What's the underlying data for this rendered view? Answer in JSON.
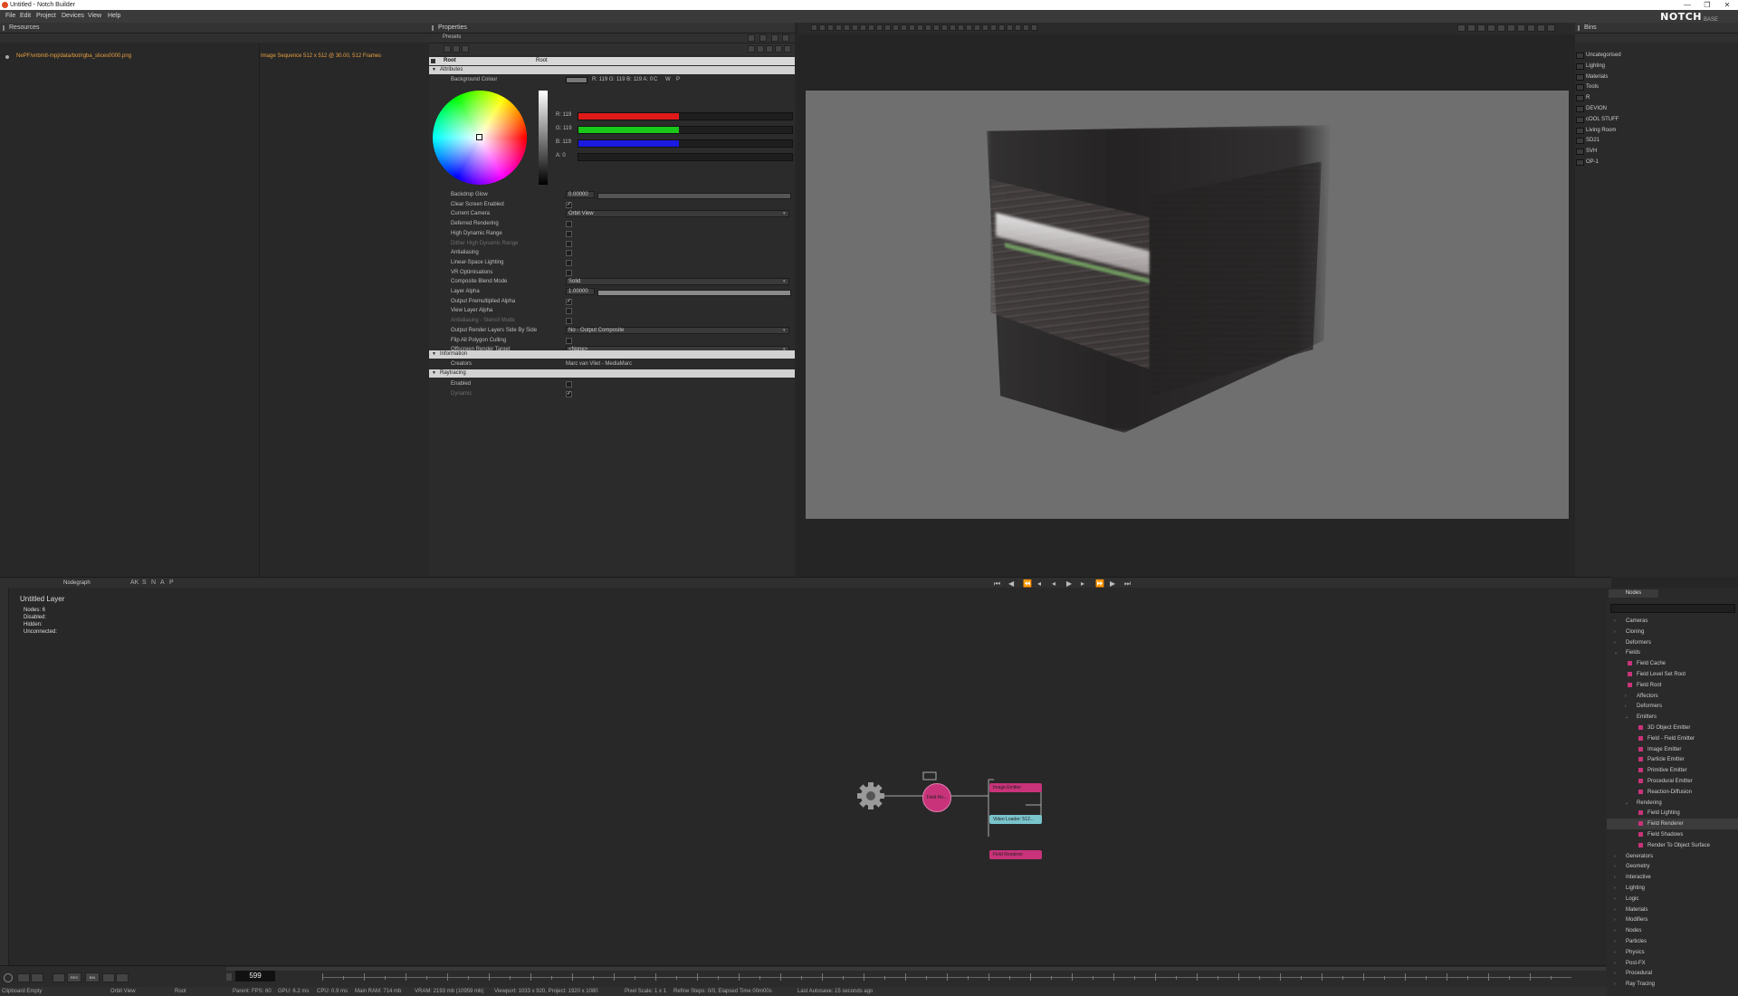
{
  "window": {
    "title": "Untitled - Notch Builder",
    "min": "—",
    "max": "❐",
    "close": "✕"
  },
  "menu": [
    "File",
    "Edit",
    "Project",
    "Devices",
    "View",
    "Help"
  ],
  "logo": {
    "text": "NOTCH",
    "sub": "BASE"
  },
  "resources": {
    "header": "Resources",
    "file_path": "NePF/vnbmtl-rnpj/data/bot/rgba_slices0000.png",
    "file_info": "Image Sequence 512 x 512 @ 30.00, 512 Frames"
  },
  "properties": {
    "header": "Properties",
    "presets": "Presets",
    "root_label": "Root",
    "root_value": "Root",
    "attributes": "Attributes",
    "background_colour": "Background Colour",
    "colour_summary": "R: 119  G: 119  B: 119  A: 0",
    "colour_btns": [
      "C",
      "W",
      "P"
    ],
    "channels": [
      {
        "label": "R: 119",
        "value": 0.47,
        "color": "#e01a1a"
      },
      {
        "label": "G: 119",
        "value": 0.47,
        "color": "#1ac81a"
      },
      {
        "label": "B: 119",
        "value": 0.47,
        "color": "#1a1ae0"
      },
      {
        "label": "A: 0",
        "value": 0.0,
        "color": "#888888"
      }
    ],
    "rows": [
      {
        "label": "Backdrop Glow",
        "type": "number",
        "value": "0.00000",
        "slider": 0.0
      },
      {
        "label": "Clear Screen Enabled",
        "type": "check",
        "checked": true
      },
      {
        "label": "Current Camera",
        "type": "select",
        "value": "Orbit View"
      },
      {
        "label": "Deferred Rendering",
        "type": "check",
        "checked": false
      },
      {
        "label": "High Dynamic Range",
        "type": "check",
        "checked": false
      },
      {
        "label": "Dither High Dynamic Range",
        "type": "check",
        "checked": false,
        "dim": true
      },
      {
        "label": "Antialiasing",
        "type": "check",
        "checked": false
      },
      {
        "label": "Linear-Space Lighting",
        "type": "check",
        "checked": false
      },
      {
        "label": "VR Optimisations",
        "type": "check",
        "checked": false
      },
      {
        "label": "Composite Blend Mode",
        "type": "select",
        "value": "Solid"
      },
      {
        "label": "Layer Alpha",
        "type": "number",
        "value": "1.00000",
        "slider": 1.0
      },
      {
        "label": "Output Premultiplied Alpha",
        "type": "check",
        "checked": true
      },
      {
        "label": "View Layer Alpha",
        "type": "check",
        "checked": false
      },
      {
        "label": "Antialiasing - Stencil Mode",
        "type": "check",
        "checked": false,
        "dim": true
      },
      {
        "label": "Output Render Layers Side By Side",
        "type": "select",
        "value": "No - Output Composite"
      },
      {
        "label": "Flip All Polygon Culling",
        "type": "check",
        "checked": false
      },
      {
        "label": "Offscreen Render Target",
        "type": "select",
        "value": "<None>"
      }
    ],
    "information": "Information",
    "creators_label": "Creators",
    "creators_value": "Marc van Vliet - MediaMarc",
    "raytracing": "Raytracing",
    "ray_rows": [
      {
        "label": "Enabled",
        "checked": false
      },
      {
        "label": "Dynamic",
        "checked": true,
        "dim": true
      }
    ]
  },
  "bins": {
    "header": "Bins",
    "items": [
      "Uncategorised",
      "Lighting",
      "Materials",
      "Tools",
      "R",
      "DEVION",
      "cOOL STUFF",
      "Living Room",
      "SD21",
      "SVH",
      "OP-1"
    ]
  },
  "nodegraph": {
    "tab": "Nodegraph",
    "toolbar_letters": [
      "AK",
      "S",
      "N",
      "A",
      "P"
    ],
    "layer_title": "Untitled  Layer",
    "stats": [
      "Nodes:  6",
      "Disabled:",
      "Hidden:",
      "Unconnected:"
    ],
    "nodes": [
      {
        "name": "Root",
        "label": "Field Ro..."
      },
      {
        "name": "image-emitter",
        "label": "Image Emitter"
      },
      {
        "name": "video-loader",
        "label": "Video Loader: 512..."
      },
      {
        "name": "field-renderer",
        "label": "Field Renderer"
      }
    ]
  },
  "nodes_panel": {
    "tab": "Nodes",
    "tree": [
      {
        "label": "Cameras",
        "level": 0,
        "tog": "+"
      },
      {
        "label": "Cloning",
        "level": 0,
        "tog": "+"
      },
      {
        "label": "Deformers",
        "level": 0,
        "tog": "+"
      },
      {
        "label": "Fields",
        "level": 0,
        "tog": "−"
      },
      {
        "label": "Field Cache",
        "level": 1,
        "sq": true
      },
      {
        "label": "Field Level Set Root",
        "level": 1,
        "sq": true
      },
      {
        "label": "Field Root",
        "level": 1,
        "sq": true
      },
      {
        "label": "Affectors",
        "level": 1,
        "tog": "+"
      },
      {
        "label": "Deformers",
        "level": 1,
        "tog": "+"
      },
      {
        "label": "Emitters",
        "level": 1,
        "tog": "−"
      },
      {
        "label": "3D Object Emitter",
        "level": 2,
        "sq": true
      },
      {
        "label": "Field - Field Emitter",
        "level": 2,
        "sq": true
      },
      {
        "label": "Image Emitter",
        "level": 2,
        "sq": true
      },
      {
        "label": "Particle Emitter",
        "level": 2,
        "sq": true
      },
      {
        "label": "Primitive Emitter",
        "level": 2,
        "sq": true
      },
      {
        "label": "Procedural Emitter",
        "level": 2,
        "sq": true
      },
      {
        "label": "Reaction-Diffusion",
        "level": 2,
        "sq": true
      },
      {
        "label": "Rendering",
        "level": 1,
        "tog": "−"
      },
      {
        "label": "Field Lighting",
        "level": 2,
        "sq": true
      },
      {
        "label": "Field Renderer",
        "level": 2,
        "sq": true,
        "selected": true
      },
      {
        "label": "Field Shadows",
        "level": 2,
        "sq": true
      },
      {
        "label": "Render To Object Surface",
        "level": 2,
        "sq": true
      },
      {
        "label": "Generators",
        "level": 0,
        "tog": "+"
      },
      {
        "label": "Geometry",
        "level": 0,
        "tog": "+"
      },
      {
        "label": "Interactive",
        "level": 0,
        "tog": "+"
      },
      {
        "label": "Lighting",
        "level": 0,
        "tog": "+"
      },
      {
        "label": "Logic",
        "level": 0,
        "tog": "+"
      },
      {
        "label": "Materials",
        "level": 0,
        "tog": "+"
      },
      {
        "label": "Modifiers",
        "level": 0,
        "tog": "+"
      },
      {
        "label": "Nodes",
        "level": 0,
        "tog": "+"
      },
      {
        "label": "Particles",
        "level": 0,
        "tog": "+"
      },
      {
        "label": "Physics",
        "level": 0,
        "tog": "+"
      },
      {
        "label": "Post-FX",
        "level": 0,
        "tog": "+"
      },
      {
        "label": "Procedural",
        "level": 0,
        "tog": "+"
      },
      {
        "label": "Ray Tracing",
        "level": 0,
        "tog": "+"
      }
    ]
  },
  "timeline": {
    "frame": "599",
    "btn_labels": [
      "RES",
      "BIN"
    ]
  },
  "status": {
    "items": [
      "Clipboard Empty",
      "Orbit View",
      "Root",
      "Parent: FPS: 60",
      "GPU: 6.2 ms",
      "CPU: 0.9 ms",
      "Main RAM: 714 mb",
      "VRAM: 2193 mb (10959 mb)",
      "Viewport: 1033 x 920, Project: 1920 x 1080",
      "Pixel Scale: 1 x 1",
      "Refine Steps: 0/0, Elapsed Time 00m00s",
      "Last Autosave: 15 seconds ago"
    ]
  },
  "colors": {
    "accent_pink": "#c8337a",
    "video_node": "#7ac4cc",
    "path_orange": "#e8a040"
  }
}
